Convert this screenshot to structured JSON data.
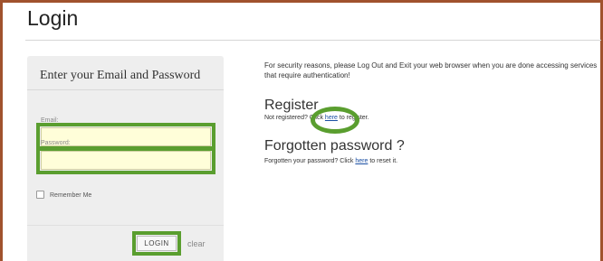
{
  "page": {
    "title": "Login",
    "accent_color": "#5a9e2f",
    "frame_color": "#a0522d"
  },
  "login_panel": {
    "heading": "Enter your Email and Password",
    "email_label": "Email:",
    "email_value": "",
    "password_label": "Password:",
    "password_value": "",
    "remember_label": "Remember Me",
    "remember_checked": false,
    "login_button": "LOGIN",
    "clear_link": "clear"
  },
  "info": {
    "security_note": "For security reasons, please Log Out and Exit your web browser when you are done accessing services that require authentication!",
    "register_heading": "Register",
    "register_prefix": "Not registered? Click ",
    "register_link": "here",
    "register_suffix": " to register.",
    "forgot_heading": "Forgotten password ?",
    "forgot_prefix": "Forgotten your password? Click ",
    "forgot_link": "here",
    "forgot_suffix": " to reset it."
  }
}
